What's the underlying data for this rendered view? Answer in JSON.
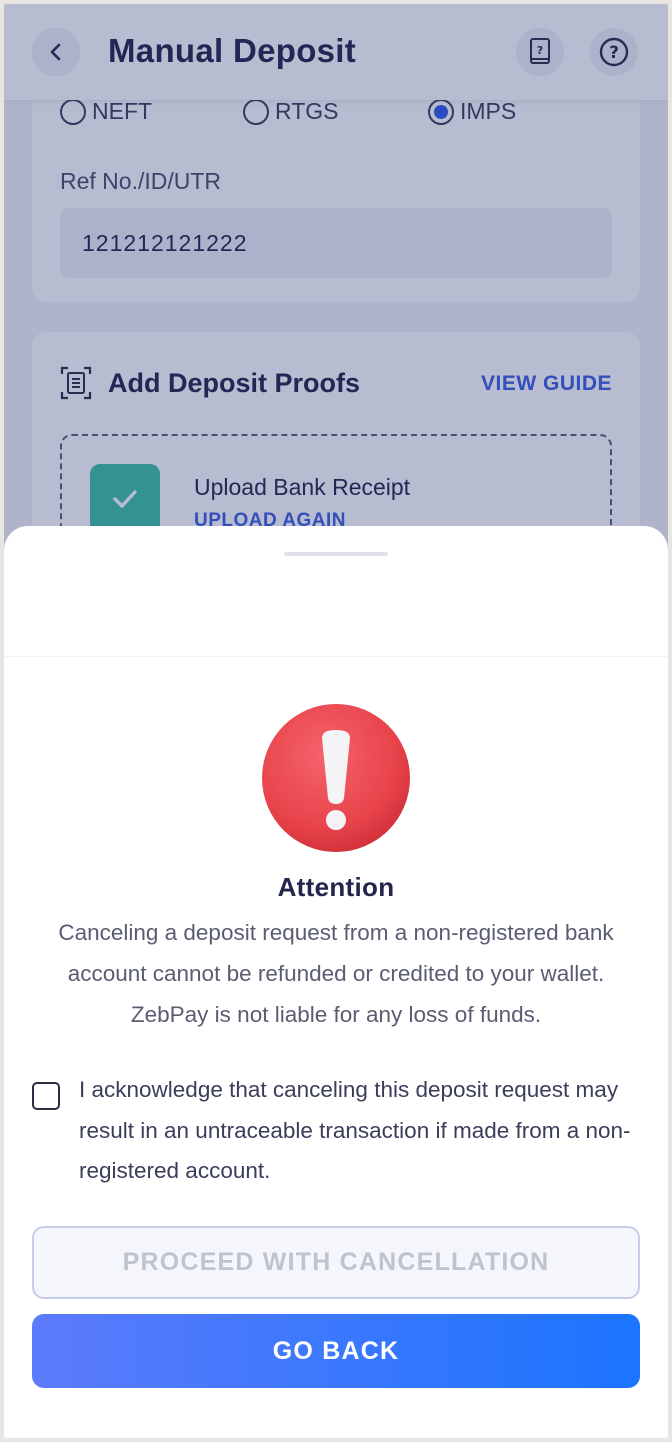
{
  "header": {
    "title": "Manual Deposit"
  },
  "transfer_mode": {
    "options": [
      "NEFT",
      "RTGS",
      "IMPS"
    ],
    "selected": "IMPS"
  },
  "reference": {
    "label": "Ref No./ID/UTR",
    "value": "121212121222"
  },
  "proofs": {
    "title": "Add Deposit Proofs",
    "view_guide": "VIEW GUIDE",
    "upload_title": "Upload Bank Receipt",
    "upload_again": "UPLOAD AGAIN"
  },
  "sheet": {
    "heading": "Attention",
    "warning": "Canceling a deposit request from a non-registered bank account cannot be refunded or credited to your wallet. ZebPay is not liable for any loss of funds.",
    "acknowledge": "I acknowledge that canceling this deposit request may result in an untraceable transaction if made from a non-registered account.",
    "acknowledge_checked": false,
    "proceed_label": "PROCEED WITH CANCELLATION",
    "go_back_label": "GO BACK"
  },
  "colors": {
    "primary_blue": "#1b74ff",
    "alert_red": "#e8434b",
    "success_green": "#3dc3a4",
    "text_dark": "#23264a"
  }
}
